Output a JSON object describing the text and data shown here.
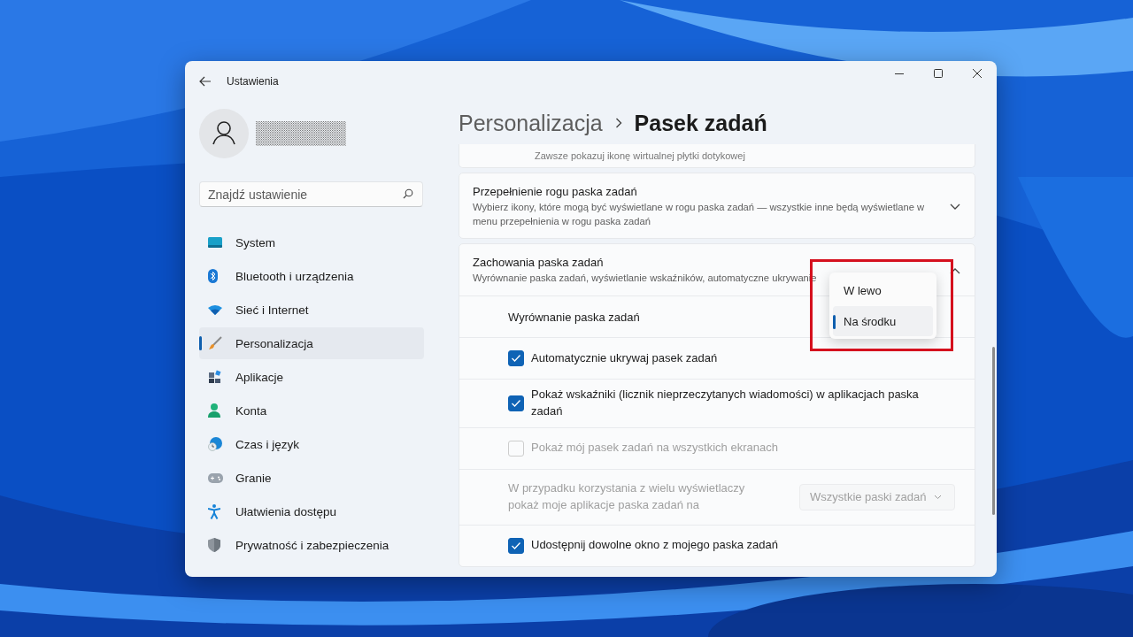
{
  "window": {
    "title": "Ustawienia"
  },
  "search": {
    "placeholder": "Znajdź ustawienie"
  },
  "nav": [
    {
      "label": "System",
      "kind": "system",
      "selected": false
    },
    {
      "label": "Bluetooth i urządzenia",
      "kind": "bluetooth",
      "selected": false
    },
    {
      "label": "Sieć i Internet",
      "kind": "network",
      "selected": false
    },
    {
      "label": "Personalizacja",
      "kind": "brush",
      "selected": true
    },
    {
      "label": "Aplikacje",
      "kind": "apps",
      "selected": false
    },
    {
      "label": "Konta",
      "kind": "person",
      "selected": false
    },
    {
      "label": "Czas i język",
      "kind": "globe",
      "selected": false
    },
    {
      "label": "Granie",
      "kind": "gamepad",
      "selected": false
    },
    {
      "label": "Ułatwienia dostępu",
      "kind": "access",
      "selected": false
    },
    {
      "label": "Prywatność i zabezpieczenia",
      "kind": "shield",
      "selected": false
    }
  ],
  "breadcrumb": [
    "Personalizacja",
    "Pasek zadań"
  ],
  "cards": [
    {
      "kind": "partial",
      "description": "Zawsze pokazuj ikonę wirtualnej płytki dotykowej"
    },
    {
      "kind": "expander",
      "title": "Przepełnienie rogu paska zadań",
      "description": "Wybierz ikony, które mogą być wyświetlane w rogu paska zadań — wszystkie inne będą wyświetlane w menu przepełnienia w rogu paska zadań",
      "expanded": false
    },
    {
      "kind": "expander",
      "title": "Zachowania paska zadań",
      "description": "Wyrównanie paska zadań, wyświetlanie wskaźników, automatyczne ukrywanie",
      "expanded": true,
      "settings": [
        {
          "kind": "dropdown",
          "label": "Wyrównanie paska zadań"
        },
        {
          "kind": "checkbox",
          "label": "Automatycznie ukrywaj pasek zadań",
          "checked": true,
          "disabled": false
        },
        {
          "kind": "checkbox",
          "label": "Pokaż wskaźniki (licznik nieprzeczytanych wiadomości) w aplikacjach paska zadań",
          "checked": true,
          "disabled": false
        },
        {
          "kind": "checkbox",
          "label": "Pokaż mój pasek zadań na wszystkich ekranach",
          "checked": false,
          "disabled": true
        },
        {
          "kind": "select",
          "label": "W przypadku korzystania z wielu wyświetlaczy pokaż moje aplikacje paska zadań na",
          "value": "Wszystkie paski zadań",
          "disabled": true
        },
        {
          "kind": "checkbox",
          "label": "Udostępnij dowolne okno z mojego paska zadań",
          "checked": true,
          "disabled": false
        }
      ]
    }
  ],
  "popup": {
    "options": [
      {
        "label": "W lewo",
        "selected": false
      },
      {
        "label": "Na środku",
        "selected": true
      }
    ]
  }
}
